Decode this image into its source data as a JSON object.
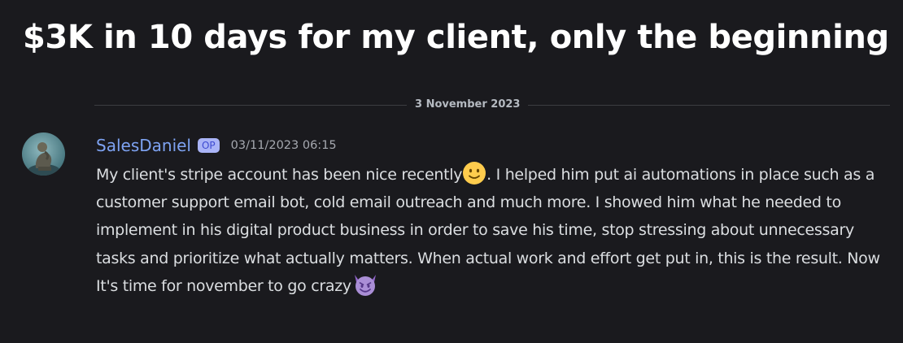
{
  "thread": {
    "title": "$3K in 10 days for my client, only the beginning"
  },
  "divider": {
    "date": "3 November 2023"
  },
  "message": {
    "author": "SalesDaniel",
    "badge": "OP",
    "timestamp": "03/11/2023 06:15",
    "text_part1": "My client's stripe account has been nice recently",
    "emoji1": "slightly-smiling-face-icon",
    "text_part2": ". I helped him put ai automations in place such as a customer support email bot, cold email outreach and much more. I showed him what he needed to implement in his digital product business in order to save his time, stop stressing about unnecessary tasks and prioritize what actually matters. When actual work and effort get put in, this is the result. Now It's time for november to go crazy",
    "emoji2": "smiling-face-with-horns-icon"
  },
  "colors": {
    "background": "#1a1a1e",
    "username": "#7ea3f2",
    "badge_bg": "#aab4f7",
    "timestamp": "#a6a9b0",
    "body_text": "#dbdee1"
  }
}
